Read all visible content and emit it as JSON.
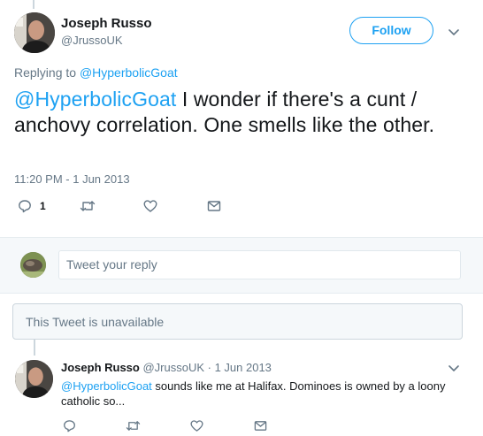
{
  "main_tweet": {
    "author_name": "Joseph Russo",
    "author_handle": "@JrussoUK",
    "follow_label": "Follow",
    "replying_prefix": "Replying to ",
    "replying_to": "@HyperbolicGoat",
    "text_mention": "@HyperbolicGoat",
    "text_body": " I wonder if there's a cunt / anchovy correlation. One smells like the other.",
    "timestamp": "11:20 PM - 1 Jun 2013",
    "reply_count": "1",
    "icons": [
      "reply-icon",
      "retweet-icon",
      "like-icon",
      "message-icon"
    ]
  },
  "reply_composer": {
    "placeholder": "Tweet your reply"
  },
  "unavailable_tweet": {
    "label": "This Tweet is unavailable"
  },
  "reply_tweet": {
    "author_name": "Joseph Russo",
    "meta": " @JrussoUK · 1 Jun 2013",
    "text_mention": "@HyperbolicGoat",
    "text_body": " sounds like me at Halifax. Dominoes is owned by a loony catholic so...",
    "icons": [
      "reply-icon",
      "retweet-icon",
      "like-icon",
      "message-icon"
    ]
  },
  "colors": {
    "accent": "#1da1f2",
    "muted": "#657786",
    "text": "#14171a",
    "border": "#e6ecf0"
  }
}
